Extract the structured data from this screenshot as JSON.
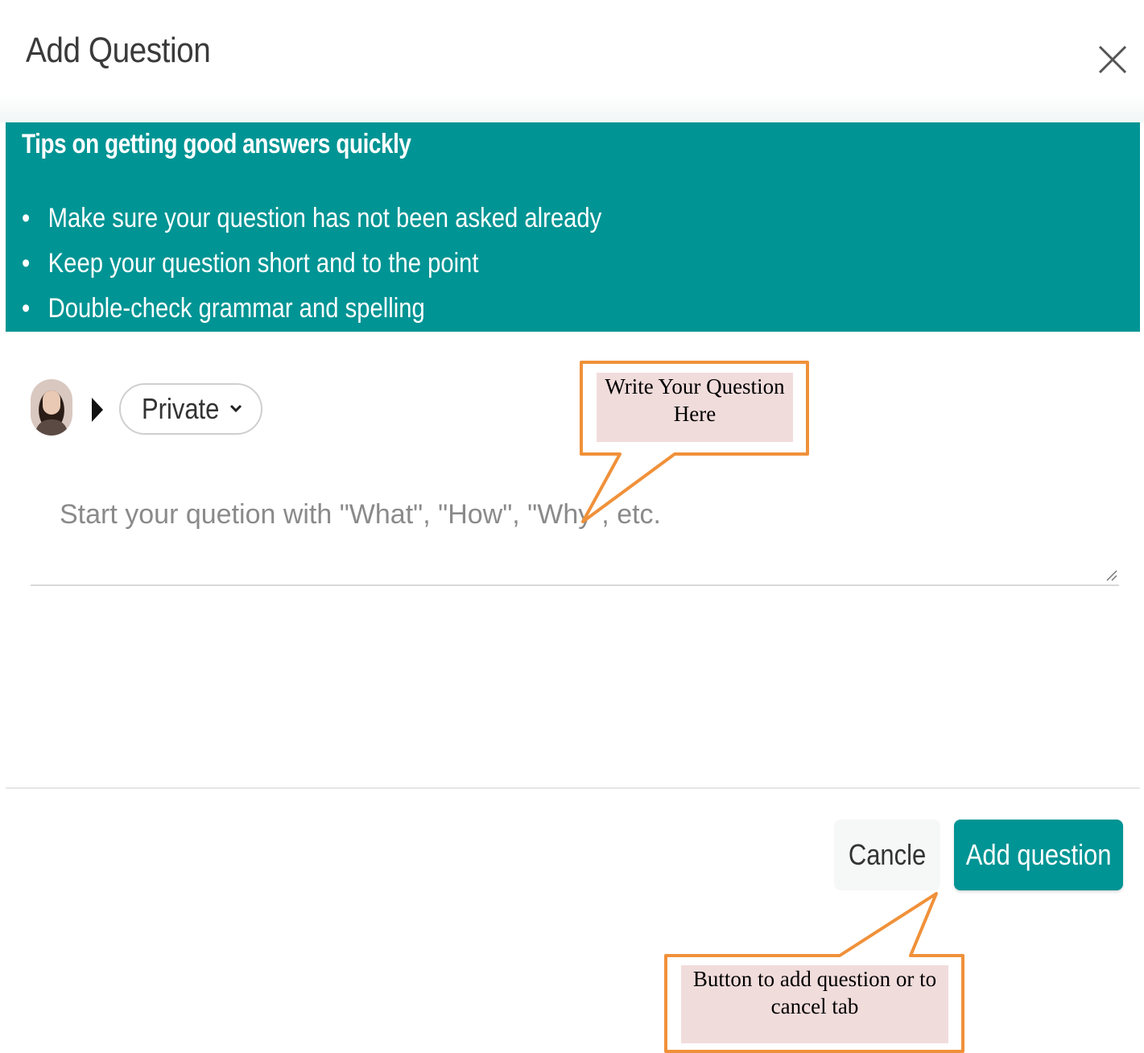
{
  "dialog": {
    "title": "Add Question"
  },
  "tips": {
    "title": "Tips on getting good answers quickly",
    "items": [
      "Make sure your question has not been asked already",
      "Keep your question short and to the point",
      "Double-check grammar and spelling"
    ]
  },
  "composer": {
    "privacy_value": "Private",
    "question_placeholder": "Start your quetion with \"What\", \"How\", \"Why\", etc."
  },
  "footer": {
    "cancel_label": "Cancle",
    "submit_label": "Add question"
  },
  "callouts": {
    "question_hint": "Write Your Question Here",
    "button_hint": "Button to add question or to cancel tab"
  },
  "colors": {
    "accent": "#009494",
    "callout_border": "#f0913a",
    "callout_fill": "#f1dcdc"
  },
  "icons": {
    "close": "close-icon",
    "caret": "caret-right-icon",
    "chevron": "chevron-down-icon",
    "resize": "resize-grip-icon"
  }
}
